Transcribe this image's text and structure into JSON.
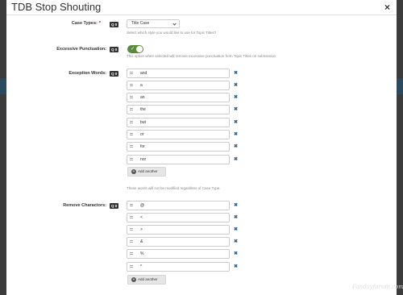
{
  "modal": {
    "title": "TDB Stop Shouting",
    "close_icon": "close-icon",
    "close_glyph": "×"
  },
  "case_types": {
    "label": "Case Types:",
    "required_mark": "*",
    "badge": "Q 0",
    "selected": "Title Case",
    "help": "Select which style you would like to use for Topic Titles?"
  },
  "excessive_punctuation": {
    "label": "Excessive Punctuation:",
    "badge": "Q 0",
    "enabled": true,
    "help": "This option when selected will remove excessive punctuation from Topic Titles on submission."
  },
  "exception_words": {
    "label": "Exception Words:",
    "badge": "Q 0",
    "items": [
      "and",
      "a",
      "an",
      "the",
      "but",
      "or",
      "for",
      "nor"
    ],
    "add_label": "Add another",
    "help": "These words will not be modified regardless of Case Type."
  },
  "remove_characters": {
    "label": "Remove Charactors:",
    "badge": "Q 0",
    "items": [
      "@",
      "<",
      ">",
      "&",
      "%",
      "^"
    ],
    "add_label": "Add another"
  },
  "watermark": "Fandayforum.com"
}
